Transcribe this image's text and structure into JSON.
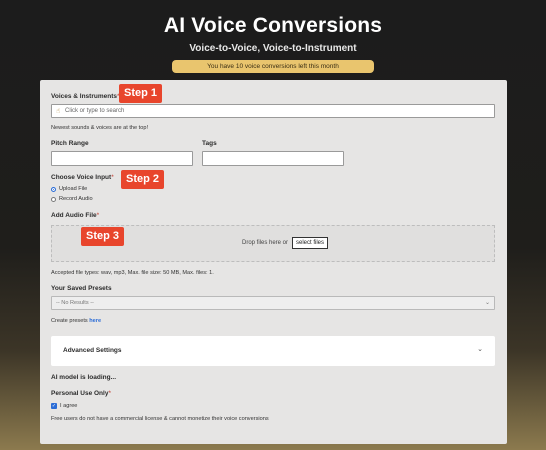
{
  "header": {
    "title": "AI Voice Conversions",
    "subtitle": "Voice-to-Voice, Voice-to-Instrument",
    "banner": "You have 10 voice conversions left this month"
  },
  "steps": {
    "step1": "Step 1",
    "step2": "Step 2",
    "step3": "Step 3"
  },
  "voices": {
    "label": "Voices & Instruments",
    "placeholder": "Click or type to search",
    "hint": "Newest sounds & voices are at the top!"
  },
  "pitch": {
    "label": "Pitch Range",
    "value": ""
  },
  "tags": {
    "label": "Tags",
    "value": ""
  },
  "voice_input": {
    "label": "Choose Voice Input",
    "options": [
      "Upload File",
      "Record Audio"
    ],
    "selected": "Upload File"
  },
  "audio_file": {
    "label": "Add Audio File",
    "drop_text": "Drop files here or",
    "select_button": "select files",
    "accepted": "Accepted file types: wav, mp3, Max. file size: 50 MB, Max. files: 1."
  },
  "presets": {
    "label": "Your Saved Presets",
    "selected": "-- No Results --",
    "create_text": "Create presets",
    "create_link": "here"
  },
  "advanced": {
    "label": "Advanced Settings"
  },
  "status": {
    "loading": "AI model is loading..."
  },
  "personal_use": {
    "label": "Personal Use Only",
    "checkbox_label": "I agree",
    "checked": true,
    "note": "Free users do not have a commercial license & cannot monetize their voice conversions"
  },
  "colors": {
    "accent_step": "#e8452c",
    "banner": "#e9c56e",
    "link": "#2b6cd6"
  }
}
